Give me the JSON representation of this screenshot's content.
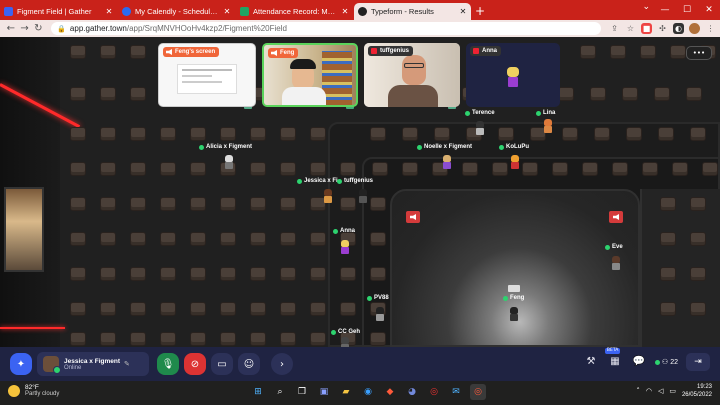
{
  "browser": {
    "tabs": [
      {
        "title": "Figment Field | Gather",
        "color": "#3b63f2",
        "active": false
      },
      {
        "title": "My Calendly - Scheduled Events",
        "color": "#2a6cf0",
        "active": false
      },
      {
        "title": "Attendance Record: May 2022 -",
        "color": "#1fa463",
        "active": false
      },
      {
        "title": "Typeform - Results",
        "color": "#222222",
        "active": true
      }
    ],
    "new_tab": "+",
    "url_host": "app.gather.town",
    "url_path": "/app/SrqMNVHOoHv4kzp2/Figment%20Field"
  },
  "video_tiles": [
    {
      "label": "Feng's screen",
      "label_color": "#f0663a"
    },
    {
      "label": "Feng",
      "label_color": "#f0663a"
    },
    {
      "label": "tuffgenius",
      "label_color": "#333333"
    },
    {
      "label": "Anna",
      "label_color": "#333333"
    }
  ],
  "options_label": "•••",
  "players": [
    {
      "name": "Alicia x Figment"
    },
    {
      "name": "Terence"
    },
    {
      "name": "Lina"
    },
    {
      "name": "Noelle x Figment"
    },
    {
      "name": "KoLuPu"
    },
    {
      "name": "Jessica x Fi"
    },
    {
      "name": "tuffgenius"
    },
    {
      "name": "Anna"
    },
    {
      "name": "Eve"
    },
    {
      "name": "PV88"
    },
    {
      "name": "Feng"
    },
    {
      "name": "CC Geh"
    }
  ],
  "gather_bar": {
    "user_name": "Jessica x Figment",
    "user_status": "Online",
    "beta_label": "BETA",
    "participant_count": "22"
  },
  "taskbar": {
    "temperature": "82°F",
    "weather": "Partly cloudy",
    "time": "19:23",
    "date": "26/05/2022"
  }
}
